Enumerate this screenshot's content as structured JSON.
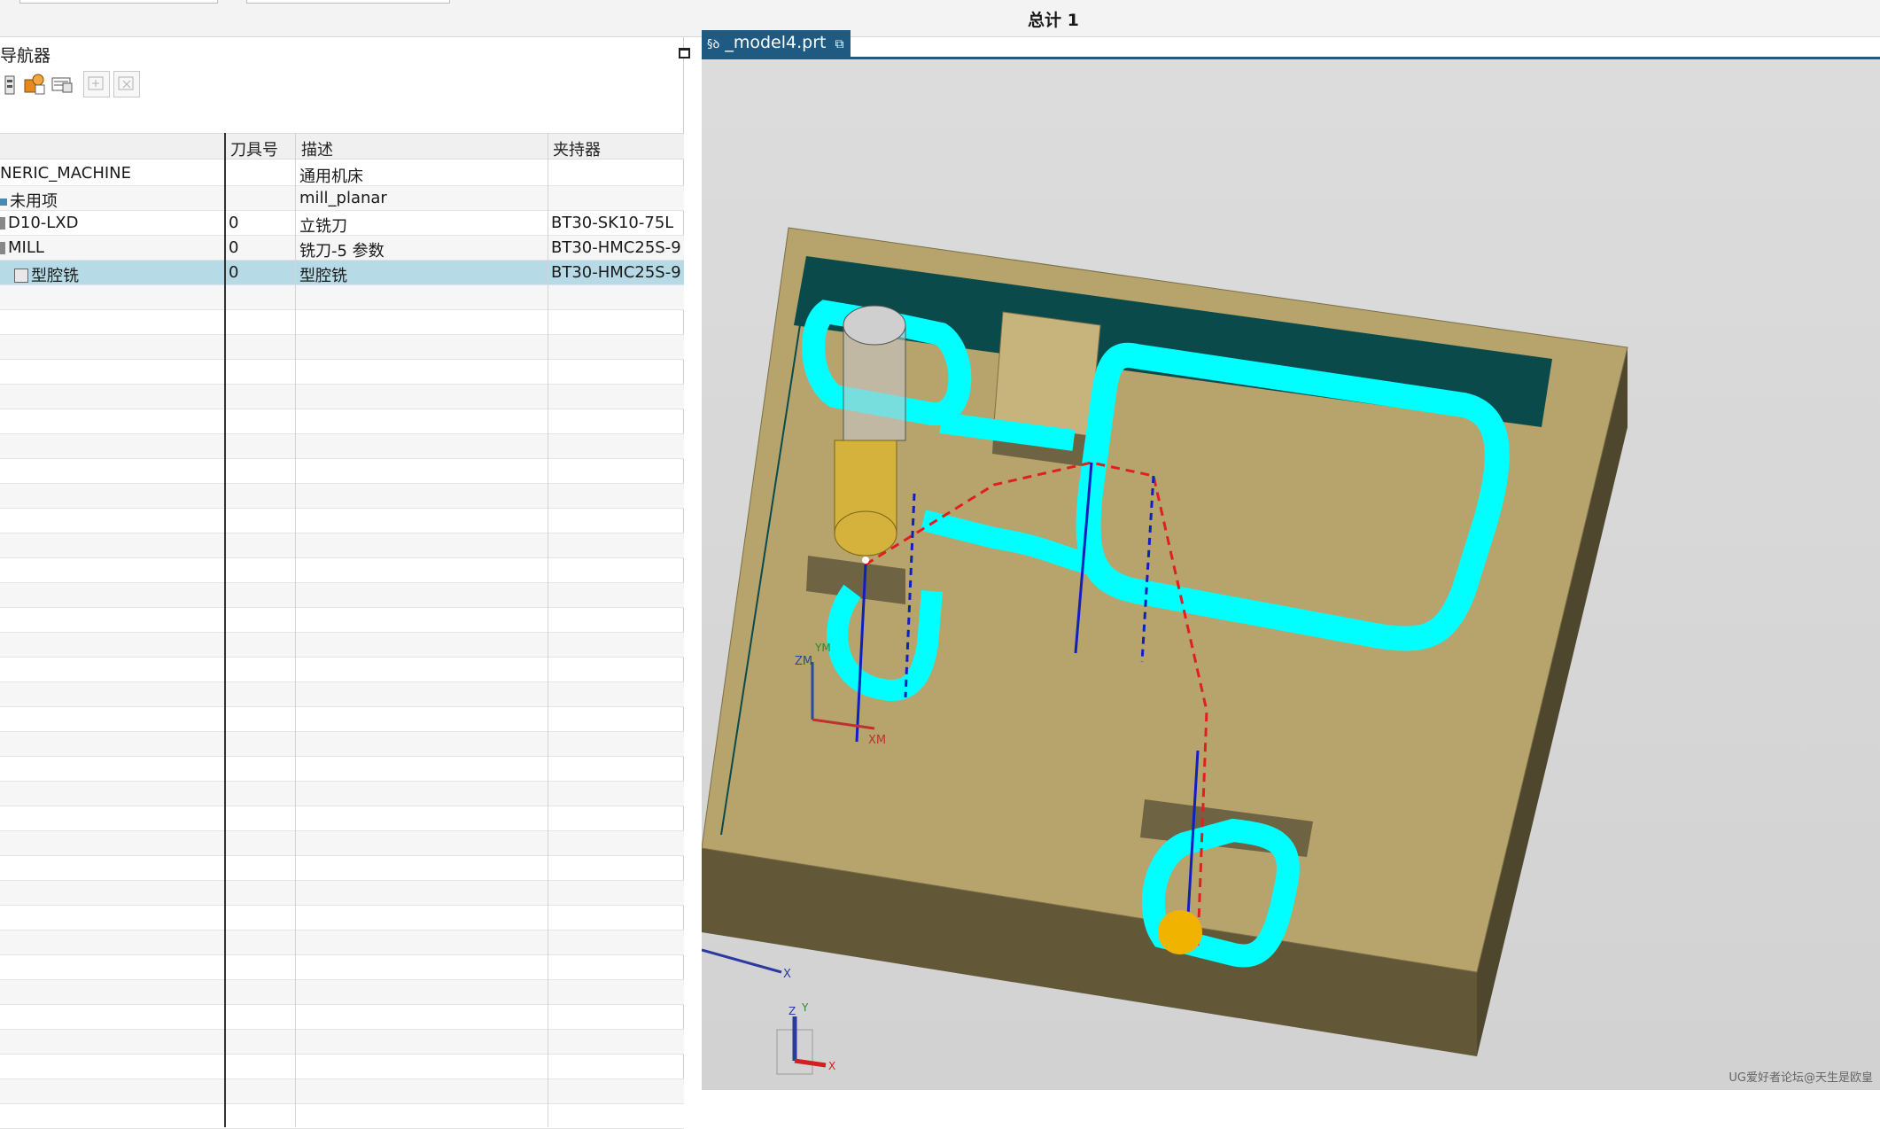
{
  "header": {
    "total_label": "总计 1"
  },
  "navigator": {
    "title": "导航器",
    "columns": [
      "刀具号",
      "描述",
      "夹持器"
    ],
    "rows": [
      {
        "name": "NERIC_MACHINE",
        "tool_no": "",
        "desc": "通用机床",
        "holder": ""
      },
      {
        "name": "未用项",
        "tool_no": "",
        "desc": "mill_planar",
        "holder": ""
      },
      {
        "name": "D10-LXD",
        "tool_no": "0",
        "desc": "立铣刀",
        "holder": "BT30-SK10-75L"
      },
      {
        "name": "MILL",
        "tool_no": "0",
        "desc": "铣刀-5 参数",
        "holder": "BT30-HMC25S-9"
      },
      {
        "name": "型腔铣",
        "tool_no": "0",
        "desc": "型腔铣",
        "holder": "BT30-HMC25S-9"
      }
    ],
    "toolbar": [
      "machine-view-icon",
      "tool-view-icon",
      "method-view-icon",
      "add-disabled-icon",
      "delete-disabled-icon"
    ]
  },
  "viewport": {
    "tab_label": "_model4.prt",
    "wcs_labels": {
      "zm": "ZM",
      "ym": "YM",
      "xm": "XM"
    },
    "triad_labels": {
      "x": "X",
      "y": "Y",
      "z": "Z"
    },
    "watermark": "UG爱好者论坛@天生是欧皇",
    "colors": {
      "stock": "#b6a46c",
      "stock_dark": "#655a3c",
      "toolpath": "#00ffff",
      "floor_teal": "#0b4a4a",
      "tool": "#d4b23b",
      "rapid": "#e02020",
      "feed": "#1020c0"
    }
  }
}
